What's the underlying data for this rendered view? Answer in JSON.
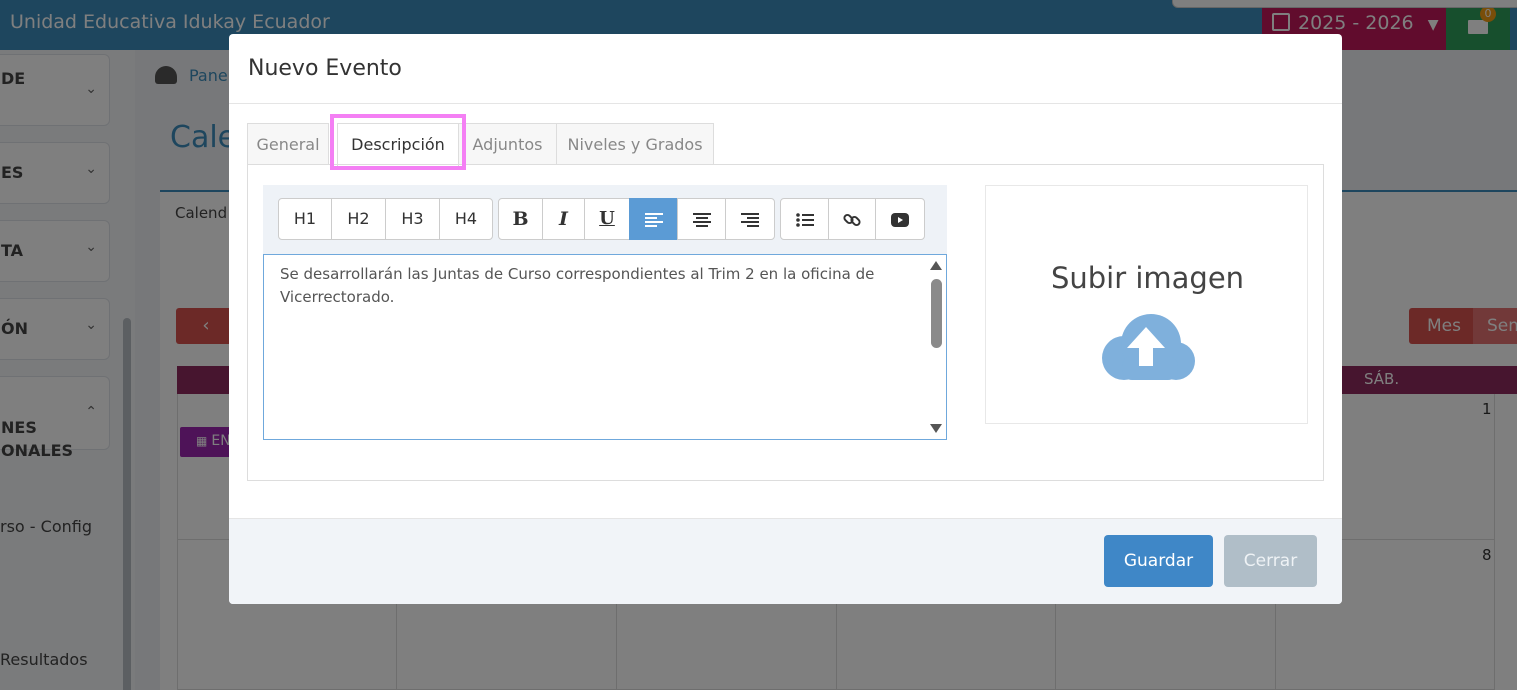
{
  "app": {
    "title": "Unidad Educativa Idukay Ecuador",
    "school_year": "2025 - 2026",
    "mail_count": "0"
  },
  "sidebar": {
    "items": [
      {
        "label": "DE"
      },
      {
        "label": "ES"
      },
      {
        "label": "TA"
      },
      {
        "label": "ÓN"
      },
      {
        "label": "NES\nONALES"
      }
    ],
    "links": [
      "rso - Config",
      "Resultados"
    ]
  },
  "background": {
    "breadcrumb": "Pane",
    "page_title": "Cale",
    "panel_tab": "Calend",
    "prev_button": "‹",
    "month_button": "Mes",
    "week_button": "Sem",
    "sat_header": "SÁB.",
    "event_label": "EN",
    "day_1": "1",
    "day_8": "8"
  },
  "modal": {
    "title": "Nuevo Evento",
    "tabs": [
      {
        "label": "General",
        "active": false
      },
      {
        "label": "Descripción",
        "active": true
      },
      {
        "label": "Adjuntos",
        "active": false
      },
      {
        "label": "Niveles y Grados",
        "active": false
      }
    ],
    "toolbar": {
      "h1": "H1",
      "h2": "H2",
      "h3": "H3",
      "h4": "H4",
      "bold": "B",
      "italic": "I",
      "underline": "U",
      "icons": [
        "align-left-icon",
        "align-center-icon",
        "align-right-icon",
        "list-icon",
        "link-icon",
        "youtube-icon"
      ]
    },
    "description_text": "Se desarrollarán las Juntas de Curso correspondientes al Trim 2 en la oficina de Vicerrectorado.",
    "upload_label": "Subir imagen",
    "save_label": "Guardar",
    "close_label": "Cerrar"
  },
  "colors": {
    "accent": "#3c8dbc",
    "active_tool": "#5b9bd5",
    "highlight": "#f47ff4",
    "save": "#3f87c7",
    "close": "#b0bec8",
    "cloud": "#7fb0dc"
  }
}
